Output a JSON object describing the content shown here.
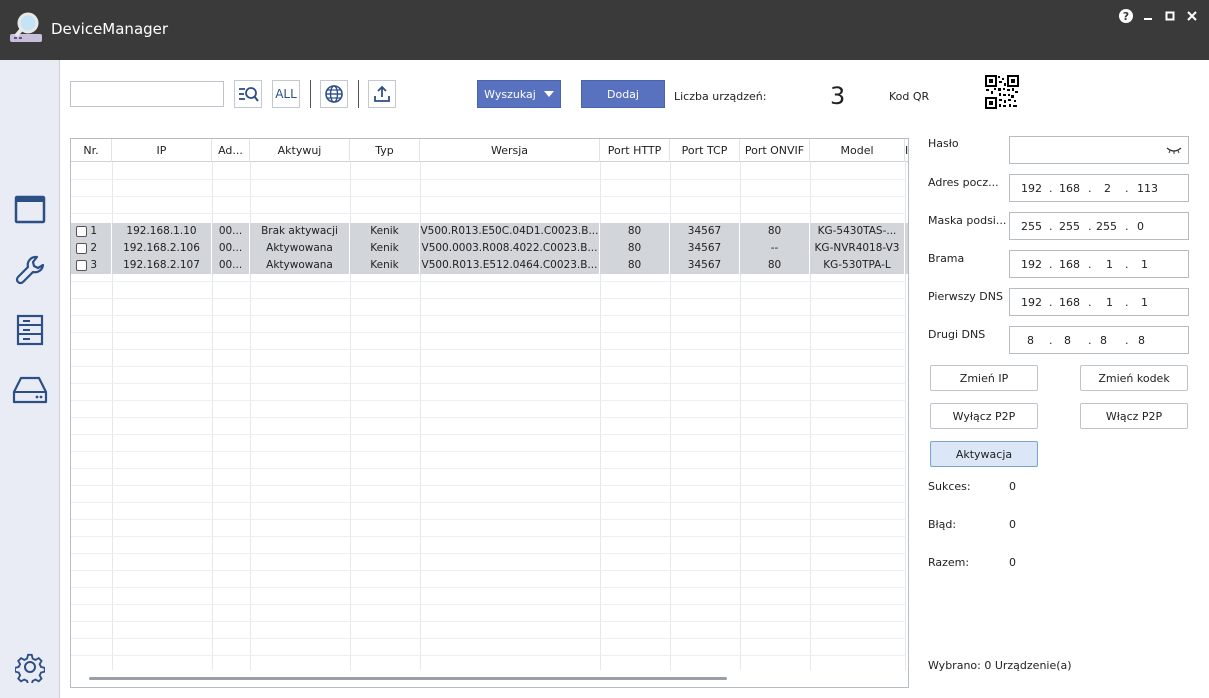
{
  "window": {
    "title": "DeviceManager",
    "help_label": "?"
  },
  "toolbar": {
    "search_value": "",
    "all_label": "ALL",
    "search_button": "Wyszukaj",
    "add_button": "Dodaj",
    "device_count_label": "Liczba urządzeń:",
    "device_count": "3",
    "qr_label": "Kod QR"
  },
  "table": {
    "columns": [
      "Nr.",
      "IP",
      "Ad...",
      "Aktywuj",
      "Typ",
      "Wersja",
      "Port HTTP",
      "Port TCP",
      "Port ONVIF",
      "Model",
      "I"
    ],
    "rows": [
      {
        "nr": "1",
        "ip": "192.168.1.10",
        "ad": "00...",
        "aktywuj": "Brak aktywacji",
        "typ": "Kenik",
        "wersja": "V500.R013.E50C.04D1.C0023.B...",
        "http": "80",
        "tcp": "34567",
        "onvif": "80",
        "model": "KG-5430TAS-..."
      },
      {
        "nr": "2",
        "ip": "192.168.2.106",
        "ad": "00...",
        "aktywuj": "Aktywowana",
        "typ": "Kenik",
        "wersja": "V500.0003.R008.4022.C0023.B...",
        "http": "80",
        "tcp": "34567",
        "onvif": "--",
        "model": "KG-NVR4018-V3"
      },
      {
        "nr": "3",
        "ip": "192.168.2.107",
        "ad": "00...",
        "aktywuj": "Aktywowana",
        "typ": "Kenik",
        "wersja": "V500.R013.E512.0464.C0023.B...",
        "http": "80",
        "tcp": "34567",
        "onvif": "80",
        "model": "KG-530TPA-L"
      }
    ]
  },
  "panel": {
    "password_label": "Hasło",
    "address_label": "Adres pocz...",
    "address": [
      "192",
      "168",
      "2",
      "113"
    ],
    "mask_label": "Maska podsi...",
    "mask": [
      "255",
      "255",
      "255",
      "0"
    ],
    "gateway_label": "Brama",
    "gateway": [
      "192",
      "168",
      "1",
      "1"
    ],
    "dns1_label": "Pierwszy DNS",
    "dns1": [
      "192",
      "168",
      "1",
      "1"
    ],
    "dns2_label": "Drugi DNS",
    "dns2": [
      "8",
      "8",
      "8",
      "8"
    ],
    "change_ip": "Zmień IP",
    "change_code": "Zmień kodek",
    "disable_p2p": "Wyłącz P2P",
    "enable_p2p": "Włącz P2P",
    "activation": "Aktywacja",
    "success_label": "Sukces:",
    "success_value": "0",
    "error_label": "Błąd:",
    "error_value": "0",
    "total_label": "Razem:",
    "total_value": "0",
    "selected_text": "Wybrano: 0 Urządzenie(a)"
  }
}
